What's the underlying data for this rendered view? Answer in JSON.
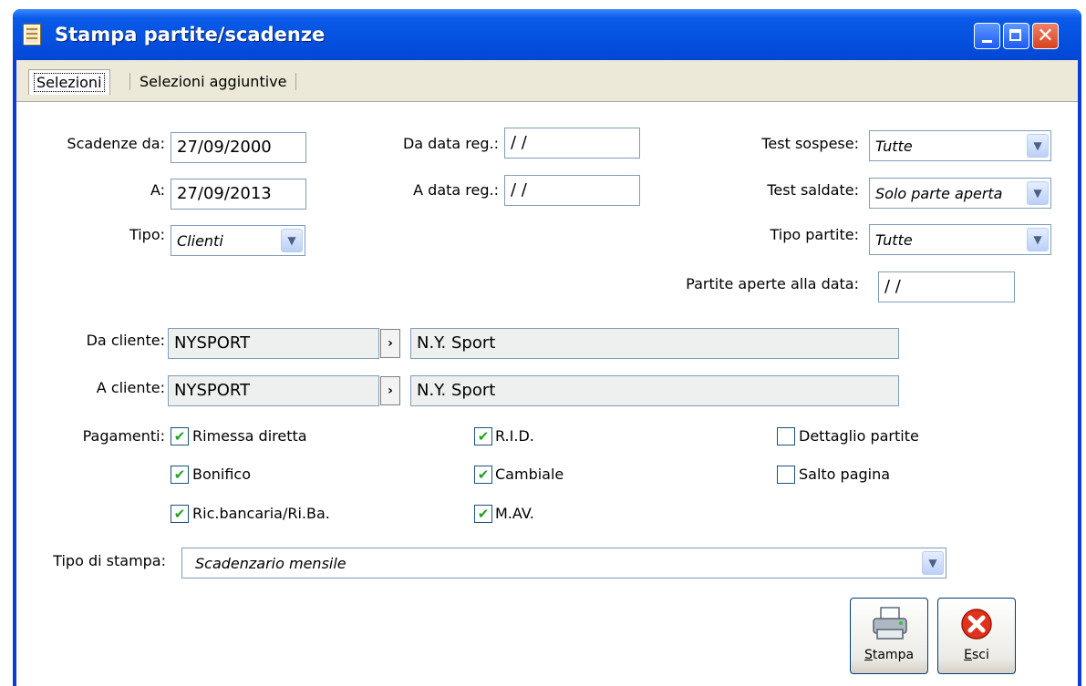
{
  "window": {
    "title": "Stampa partite/scadenze"
  },
  "tabs": [
    {
      "label": "Selezioni"
    },
    {
      "label": "Selezioni aggiuntive"
    }
  ],
  "form": {
    "scadenze_da": {
      "label": "Scadenze da:",
      "value": "27/09/2000"
    },
    "scadenze_a": {
      "label": "A:",
      "value": "27/09/2013"
    },
    "tipo": {
      "label": "Tipo:",
      "value": "Clienti"
    },
    "da_data_reg": {
      "label": "Da data reg.:",
      "value": " /  /"
    },
    "a_data_reg": {
      "label": "A data reg.:",
      "value": " /  /"
    },
    "test_sospese": {
      "label": "Test sospese:",
      "value": "Tutte"
    },
    "test_saldate": {
      "label": "Test saldate:",
      "value": "Solo parte aperta"
    },
    "tipo_partite": {
      "label": "Tipo partite:",
      "value": "Tutte"
    },
    "partite_aperte": {
      "label": "Partite aperte alla data:",
      "value": " /  /"
    },
    "da_cliente": {
      "label": "Da cliente:",
      "code": "NYSPORT",
      "name": "N.Y. Sport"
    },
    "a_cliente": {
      "label": "A cliente:",
      "code": "NYSPORT",
      "name": "N.Y. Sport"
    },
    "pagamenti_label": "Pagamenti:",
    "pagamenti": [
      {
        "label": "Rimessa diretta",
        "checked": true
      },
      {
        "label": "Bonifico",
        "checked": true
      },
      {
        "label": "Ric.bancaria/Ri.Ba.",
        "checked": true
      },
      {
        "label": "R.I.D.",
        "checked": true
      },
      {
        "label": "Cambiale",
        "checked": true
      },
      {
        "label": "M.AV.",
        "checked": true
      }
    ],
    "options": [
      {
        "label": "Dettaglio partite",
        "checked": false
      },
      {
        "label": "Salto pagina",
        "checked": false
      }
    ],
    "tipo_stampa": {
      "label": "Tipo di stampa:",
      "value": "Scadenzario mensile"
    }
  },
  "buttons": {
    "stampa": {
      "label_first": "S",
      "label_rest": "tampa"
    },
    "esci": {
      "label_first": "E",
      "label_rest": "sci"
    }
  },
  "icons": {
    "dropdown": "chevron-down-icon",
    "zoom": "chevron-right-icon",
    "printer": "printer-icon",
    "exit": "close-circle-icon"
  },
  "colors": {
    "titlebar": "#0551e0",
    "panel_bg": "#ffffff",
    "tab_strip_bg": "#ece9d8",
    "check_mark": "#21a121",
    "exit_red": "#e0321c"
  }
}
